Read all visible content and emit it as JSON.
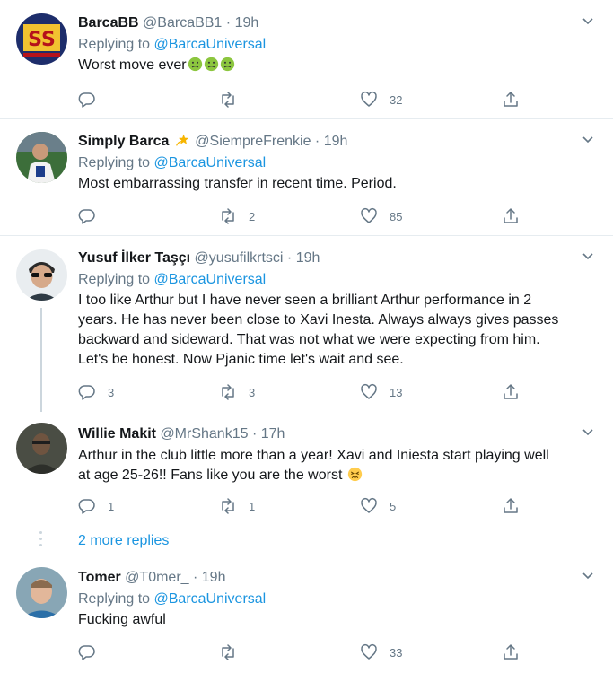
{
  "tweets": [
    {
      "name": "BarcaBB",
      "handle": "@BarcaBB1",
      "time": "19h",
      "reply_label": "Replying to",
      "reply_to": "@BarcaUniversal",
      "text": "Worst move ever",
      "emoji": [
        "nauseated-face",
        "nauseated-face",
        "nauseated-face"
      ],
      "replies": "",
      "retweets": "",
      "likes": "32"
    },
    {
      "name": "Simply Barca",
      "badge": "dizzy-star",
      "handle": "@SiempreFrenkie",
      "time": "19h",
      "reply_label": "Replying to",
      "reply_to": "@BarcaUniversal",
      "text": "Most embarrassing transfer in recent time. Period.",
      "replies": "",
      "retweets": "2",
      "likes": "85"
    },
    {
      "name": "Yusuf İlker Taşçı",
      "handle": "@yusufilkrtsci",
      "time": "19h",
      "reply_label": "Replying to",
      "reply_to": "@BarcaUniversal",
      "text_lines": [
        "I too like Arthur but I have never seen a brilliant Arthur performance in 2",
        "years. He has never been close to Xavi Inesta. Always always gives passes",
        "backward and sideward. That was not what we were expecting from him.",
        "Let's be honest. Now Pjanic time let's wait and see."
      ],
      "replies": "3",
      "retweets": "3",
      "likes": "13"
    },
    {
      "name": "Willie Makit",
      "handle": "@MrShank15",
      "time": "17h",
      "text_lines": [
        "Arthur in the club little more than a year! Xavi and Iniesta start playing well",
        "at age 25-26!! Fans like you are the worst"
      ],
      "emoji": [
        "confounded-face"
      ],
      "replies": "1",
      "retweets": "1",
      "likes": "5"
    },
    {
      "name": "Tomer",
      "handle": "@T0mer_",
      "time": "19h",
      "reply_label": "Replying to",
      "reply_to": "@BarcaUniversal",
      "text": "Fucking awful",
      "replies": "",
      "retweets": "",
      "likes": "33"
    }
  ],
  "more_replies": "2 more replies",
  "separator": "·",
  "colors": {
    "link": "#1b95e0",
    "muted": "#657786",
    "text": "#14171a",
    "border": "#e6ecf0"
  }
}
